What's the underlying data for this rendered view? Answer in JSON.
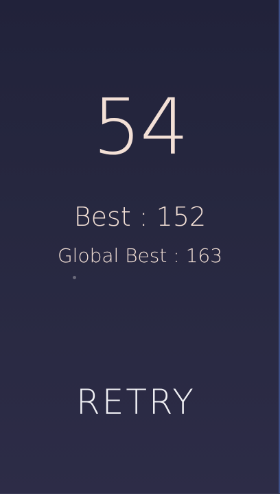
{
  "score": {
    "current": "54"
  },
  "stats": {
    "best": "Best : 152",
    "global_best": "Global Best : 163"
  },
  "actions": {
    "retry_label": "RETRY"
  },
  "colors": {
    "background_top": "#21223a",
    "background_bottom": "#2d2c47",
    "text_primary": "#f3e0d6",
    "text_button": "#f1f1f5",
    "edge_accent": "#3e4f86"
  }
}
